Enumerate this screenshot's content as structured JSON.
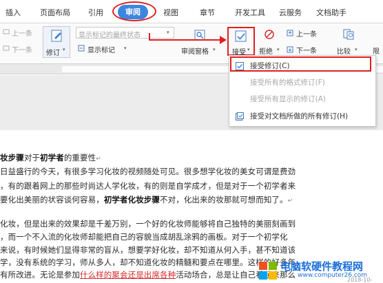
{
  "tabs": [
    "插入",
    "页面布局",
    "引用",
    "审阅",
    "视图",
    "章节",
    "开发工具",
    "云服务",
    "文档助手"
  ],
  "active_tab": "审阅",
  "ribbon": {
    "prev_change": "上一条",
    "next_change": "下一条",
    "track_changes": "修订",
    "markup_select": "显示标记的最终状态",
    "show_markup": "显示标记",
    "review_pane": "审阅窗格",
    "accept": "接受",
    "reject": "拒绝",
    "prev": "上一条",
    "next": "下一条",
    "compare": "比较",
    "restrict": "限"
  },
  "menu": {
    "accept_change": "接受修订(C)",
    "accept_all_format": "接受所有的格式修订(F)",
    "accept_all_shown": "接受所有显示的修订(A)",
    "accept_all": "接受对文档所做的所有修订(H)"
  },
  "doc": {
    "l1a": "妆步骤",
    "l1b": "对于",
    "l1c": "初学者",
    "l1d": "的重要性",
    "l2": "日益盛行的今天，有很多学习化妆的视频随处可见。很多想学化妆的美女可谓是费劲",
    "l3": "，有的跟着网上的那些时尚达人学化妆，有的则是自学成才，但是对于一个初学者来",
    "l4a": "要化出美丽的状容谈何容易，",
    "l4b": "初学者化妆步骤",
    "l4c": "不对，化出来的妆那就可想而知了。",
    "l5": "化妆，但是出来的效果却是千差万别，一个好的化妆师能够将自己独特的美丽刻画到",
    "l6": "，而一个不入流的化妆师却能把自己的容貌当成胡乱涂鸦的画板。对于一个初学化",
    "l7": "来说，有时候她们显得非常的盲从，想要学好化妆，却不知道从何入手，甚不知道该",
    "l8": "学，没有系统的学习，师从多人，却不知道化妆的精髓和要点在哪里。这样的好多年，",
    "l9a": "有所改进。无论是参加",
    "l9b": "什么样的聚会还是出席各种",
    "l9c": "活动场合，总是让自己看起来那么"
  },
  "watermark": {
    "title": "电脑软硬件教程网",
    "url": "www.computer26.com",
    "date": "2018-10-"
  },
  "colors": {
    "accent": "#3d86e0",
    "highlight": "#e01e1e",
    "revision": "#d42c2c"
  }
}
